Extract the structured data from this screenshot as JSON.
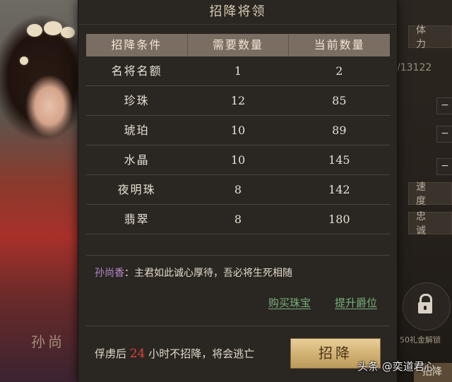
{
  "dialog": {
    "title": "招降将领",
    "table": {
      "headers": [
        "招降条件",
        "需要数量",
        "当前数量"
      ],
      "rows": [
        {
          "condition": "名将名额",
          "required": "1",
          "current": "2"
        },
        {
          "condition": "珍珠",
          "required": "12",
          "current": "85"
        },
        {
          "condition": "琥珀",
          "required": "10",
          "current": "89"
        },
        {
          "condition": "水晶",
          "required": "10",
          "current": "145"
        },
        {
          "condition": "夜明珠",
          "required": "8",
          "current": "142"
        },
        {
          "condition": "翡翠",
          "required": "8",
          "current": "180"
        }
      ]
    },
    "quote": {
      "speaker": "孙尚香",
      "separator": "：",
      "text": "主君如此诚心厚待，吾必将生死相随"
    },
    "links": {
      "buy_jewels": "购买珠宝",
      "upgrade_rank": "提升爵位"
    },
    "warning": {
      "prefix": "俘虏后",
      "hours": "24",
      "suffix": "小时不招降，将会逃亡"
    },
    "surrender_button": "招降"
  },
  "background": {
    "general_name": "孙尚",
    "side_panel": {
      "stamina_label": "体 力",
      "stamina_value": "/13122",
      "speed_label": "速 度",
      "loyalty_label": "忠 诚",
      "lock_caption": "50礼金解锁",
      "bottom_button": "招降"
    }
  },
  "watermark": "头条 @奕道君心",
  "colors": {
    "panel": "#2a2622",
    "header": "#7a6e62",
    "speaker": "#b68ad0",
    "link": "#79b27a",
    "hours": "#e0403a",
    "button": "#d1b072"
  }
}
